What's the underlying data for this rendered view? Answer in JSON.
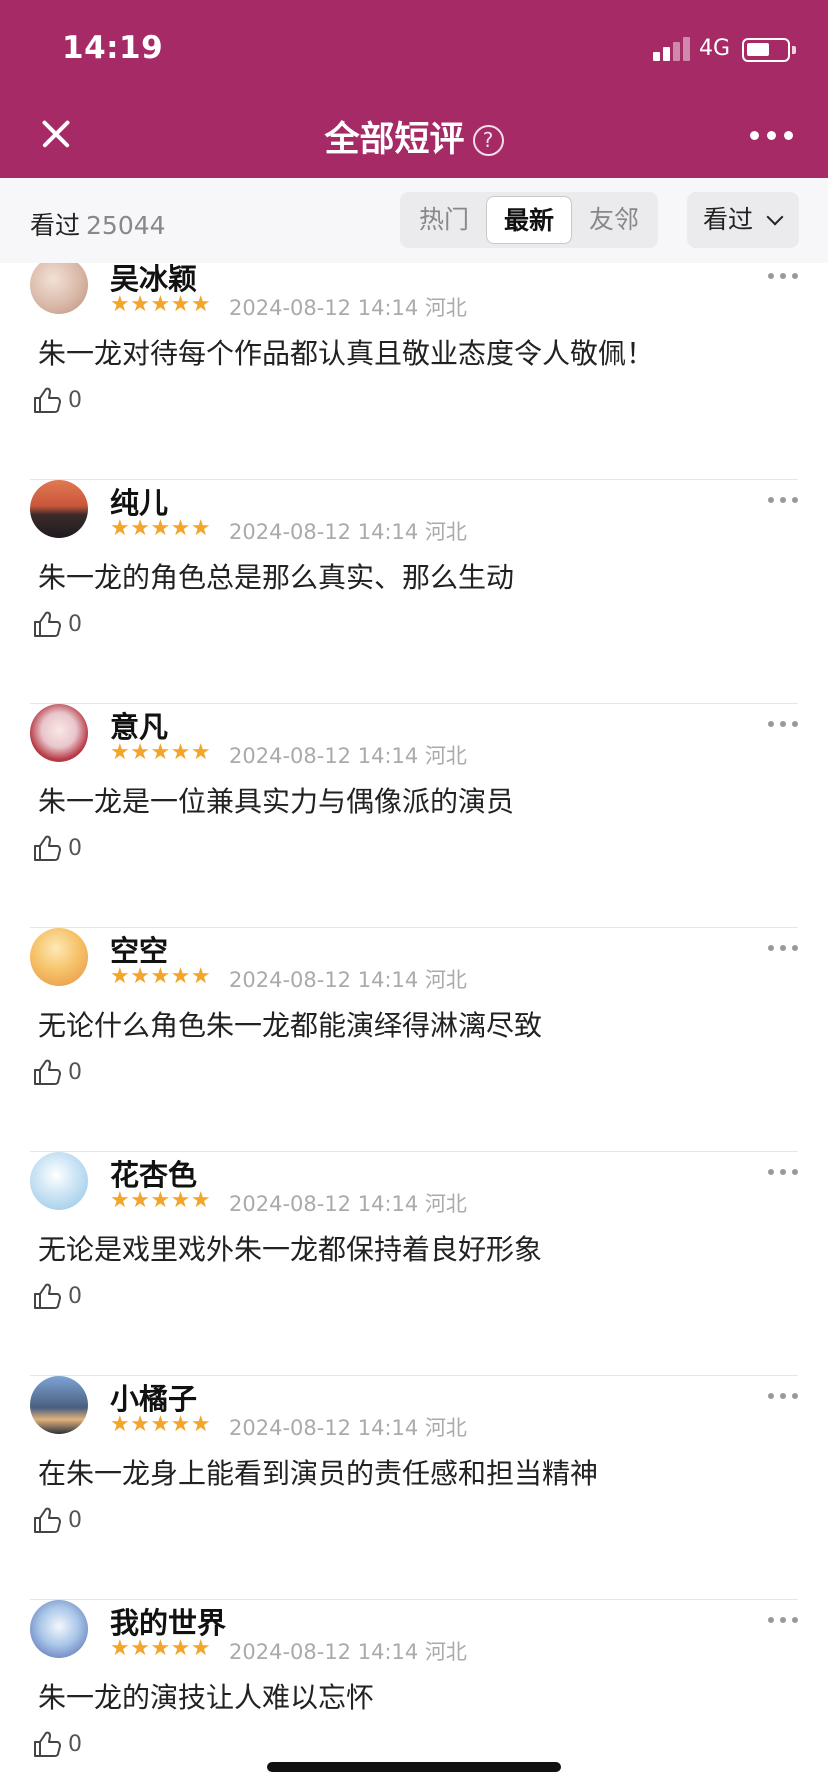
{
  "status_bar": {
    "time": "14:19",
    "network": "4G"
  },
  "header": {
    "title": "全部短评",
    "help_icon": "question-circle-icon"
  },
  "filter": {
    "seen_label": "看过",
    "seen_count": "25044",
    "tabs": [
      {
        "label": "热门",
        "active": false
      },
      {
        "label": "最新",
        "active": true
      },
      {
        "label": "友邻",
        "active": false
      }
    ],
    "dropdown_label": "看过"
  },
  "reviews": [
    {
      "user": "吴冰颖",
      "rating": "★★★★★",
      "date": "2024-08-12 14:14",
      "location": "河北",
      "content": "朱一龙对待每个作品都认真且敬业态度令人敬佩！",
      "likes": "0",
      "avatar_color": "#d9b8a8"
    },
    {
      "user": "纯儿",
      "rating": "★★★★★",
      "date": "2024-08-12 14:14",
      "location": "河北",
      "content": "朱一龙的角色总是那么真实、那么生动",
      "likes": "0",
      "avatar_color": "#c96a4a"
    },
    {
      "user": "意凡",
      "rating": "★★★★★",
      "date": "2024-08-12 14:14",
      "location": "河北",
      "content": "朱一龙是一位兼具实力与偶像派的演员",
      "likes": "0",
      "avatar_color": "#e8c6cc"
    },
    {
      "user": "空空",
      "rating": "★★★★★",
      "date": "2024-08-12 14:14",
      "location": "河北",
      "content": "无论什么角色朱一龙都能演绎得淋漓尽致",
      "likes": "0",
      "avatar_color": "#f0b25a"
    },
    {
      "user": "花杏色",
      "rating": "★★★★★",
      "date": "2024-08-12 14:14",
      "location": "河北",
      "content": "无论是戏里戏外朱一龙都保持着良好形象",
      "likes": "0",
      "avatar_color": "#8fc3e6"
    },
    {
      "user": "小橘子",
      "rating": "★★★★★",
      "date": "2024-08-12 14:14",
      "location": "河北",
      "content": "在朱一龙身上能看到演员的责任感和担当精神",
      "likes": "0",
      "avatar_color": "#4a5f80"
    },
    {
      "user": "我的世界",
      "rating": "★★★★★",
      "date": "2024-08-12 14:14",
      "location": "河北",
      "content": "朱一龙的演技让人难以忘怀",
      "likes": "0",
      "avatar_color": "#a9c6e8"
    }
  ]
}
